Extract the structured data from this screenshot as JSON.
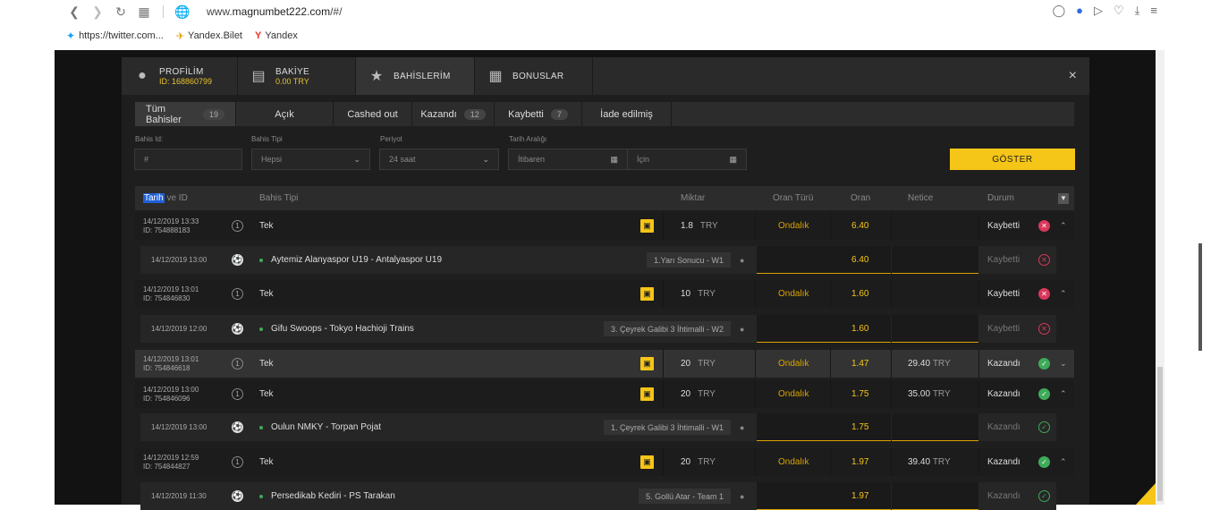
{
  "browser": {
    "url_prefix": "www.",
    "url_host": "magnumbet222.com",
    "url_path": "/#/",
    "bookmarks": [
      {
        "label": "https://twitter.com...",
        "icon": "twitter-icon"
      },
      {
        "label": "Yandex.Bilet",
        "icon": "plane-icon"
      },
      {
        "label": "Yandex",
        "icon": "yandex-icon"
      }
    ]
  },
  "modal": {
    "tabs": [
      {
        "title": "PROFİLİM",
        "sub": "ID: 168860799",
        "icon": "user-icon"
      },
      {
        "title": "BAKİYE",
        "sub": "0.00 TRY",
        "icon": "wallet-icon"
      },
      {
        "title": "BAHİSLERİM",
        "sub": "",
        "icon": "trophy-icon"
      },
      {
        "title": "BONUSLAR",
        "sub": "",
        "icon": "gift-icon"
      }
    ],
    "close": "×"
  },
  "filters": {
    "tabs": [
      {
        "label": "Tüm Bahisler",
        "count": "19"
      },
      {
        "label": "Açık",
        "count": ""
      },
      {
        "label": "Cashed out",
        "count": ""
      },
      {
        "label": "Kazandı",
        "count": "12"
      },
      {
        "label": "Kaybetti",
        "count": "7"
      },
      {
        "label": "İade edilmiş",
        "count": ""
      }
    ],
    "bet_id_label": "Bahis Id:",
    "bet_id_placeholder": "#",
    "bet_type_label": "Bahis Tipi",
    "bet_type_value": "Hepsi",
    "period_label": "Periyot",
    "period_value": "24 saat",
    "date_range_label": "Tarih Aralığı",
    "from_placeholder": "İtibaren",
    "to_placeholder": "İçin",
    "show_button": "GÖSTER"
  },
  "table": {
    "headers": {
      "date_hl": "Tarih",
      "date_rest": "ve ID",
      "bet_type": "Bahis Tipi",
      "amount": "Miktar",
      "odds_type": "Oran Türü",
      "odds": "Oran",
      "result": "Netice",
      "status": "Durum"
    },
    "rows": [
      {
        "kind": "bet",
        "date": "14/12/2019 13:33",
        "id": "ID: 754888183",
        "type": "Tek",
        "amount": "1.8",
        "currency": "TRY",
        "odds_type": "Ondalık",
        "odds": "6.40",
        "net": "",
        "net_cur": "",
        "status": "Kaybetti",
        "result": "lost",
        "chev": "^"
      },
      {
        "kind": "sub",
        "date": "14/12/2019 13:00",
        "event": "Aytemiz Alanyaspor U19 - Antalyaspor U19",
        "market": "1.Yarı Sonucu - W1",
        "odds": "6.40",
        "status": "Kaybetti",
        "result": "lost"
      },
      {
        "kind": "bet",
        "date": "14/12/2019 13:01",
        "id": "ID: 754846830",
        "type": "Tek",
        "amount": "10",
        "currency": "TRY",
        "odds_type": "Ondalık",
        "odds": "1.60",
        "net": "",
        "net_cur": "",
        "status": "Kaybetti",
        "result": "lost",
        "chev": "^"
      },
      {
        "kind": "sub",
        "date": "14/12/2019 12:00",
        "event": "Gifu Swoops - Tokyo Hachioji Trains",
        "market": "3. Çeyrek Galibi 3 İhtimalli - W2",
        "odds": "1.60",
        "status": "Kaybetti",
        "result": "lost"
      },
      {
        "kind": "bet",
        "hl": true,
        "date": "14/12/2019 13:01",
        "id": "ID: 754846618",
        "type": "Tek",
        "amount": "20",
        "currency": "TRY",
        "odds_type": "Ondalık",
        "odds": "1.47",
        "net": "29.40",
        "net_cur": "TRY",
        "status": "Kazandı",
        "result": "won",
        "chev": "v"
      },
      {
        "kind": "bet",
        "date": "14/12/2019 13:00",
        "id": "ID: 754846096",
        "type": "Tek",
        "amount": "20",
        "currency": "TRY",
        "odds_type": "Ondalık",
        "odds": "1.75",
        "net": "35.00",
        "net_cur": "TRY",
        "status": "Kazandı",
        "result": "won",
        "chev": "^"
      },
      {
        "kind": "sub",
        "date": "14/12/2019 13:00",
        "event": "Oulun NMKY - Torpan Pojat",
        "market": "1. Çeyrek Galibi 3 İhtimalli - W1",
        "odds": "1.75",
        "status": "Kazandı",
        "result": "won"
      },
      {
        "kind": "bet",
        "date": "14/12/2019 12:59",
        "id": "ID: 754844827",
        "type": "Tek",
        "amount": "20",
        "currency": "TRY",
        "odds_type": "Ondalık",
        "odds": "1.97",
        "net": "39.40",
        "net_cur": "TRY",
        "status": "Kazandı",
        "result": "won",
        "chev": "^"
      },
      {
        "kind": "sub",
        "date": "14/12/2019 11:30",
        "event": "Persedikab Kediri - PS Tarakan",
        "market": "5. Gollü Atar - Team 1",
        "odds": "1.97",
        "status": "Kazandı",
        "result": "won"
      }
    ]
  },
  "colors": {
    "accent": "#f5c518",
    "lost": "#d9385b",
    "won": "#3eaa5a"
  }
}
